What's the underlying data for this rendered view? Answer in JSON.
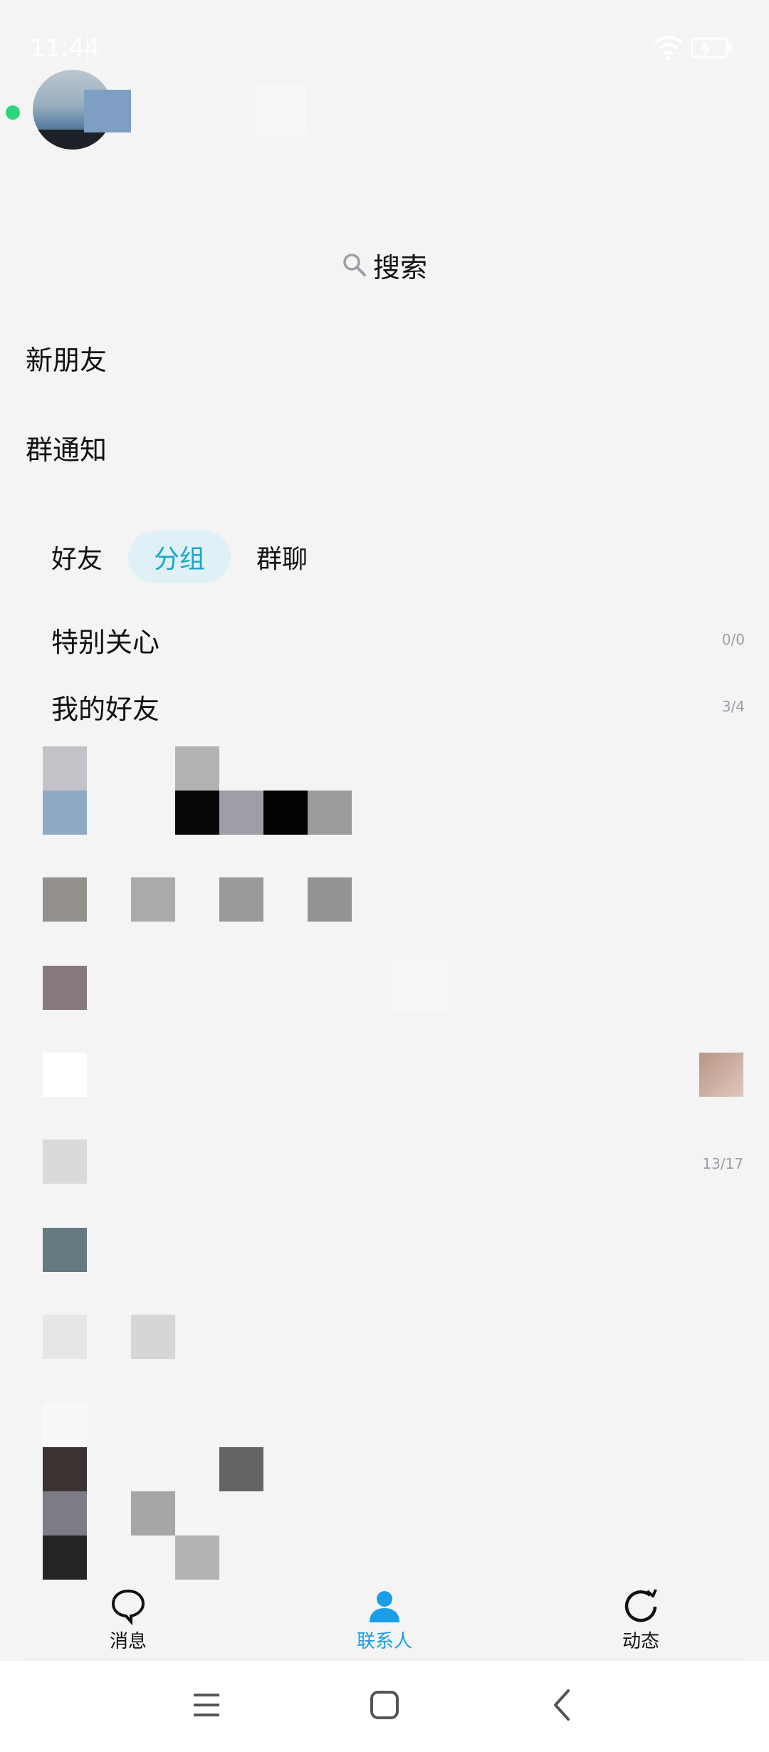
{
  "status_bar": {
    "time": "11:44"
  },
  "header": {
    "profile_name": ""
  },
  "search": {
    "label": "搜索"
  },
  "entries": {
    "new_friends": "新朋友",
    "group_notice": "群通知"
  },
  "tabs": [
    {
      "label": "好友",
      "active": false
    },
    {
      "label": "分组",
      "active": true
    },
    {
      "label": "群聊",
      "active": false
    }
  ],
  "groups": [
    {
      "name": "特别关心",
      "count": "0/0"
    },
    {
      "name": "我的好友",
      "count": "3/4"
    }
  ],
  "extra_count": "13/17",
  "bottom_nav": [
    {
      "label": "消息",
      "icon": "message-icon",
      "active": false
    },
    {
      "label": "联系人",
      "icon": "contacts-icon",
      "active": true
    },
    {
      "label": "动态",
      "icon": "moments-icon",
      "active": false
    }
  ],
  "colors": {
    "accent": "#1da5c8",
    "active_nav": "#1b9ee6",
    "online": "#2bd67b",
    "background": "#f4f4f4"
  }
}
